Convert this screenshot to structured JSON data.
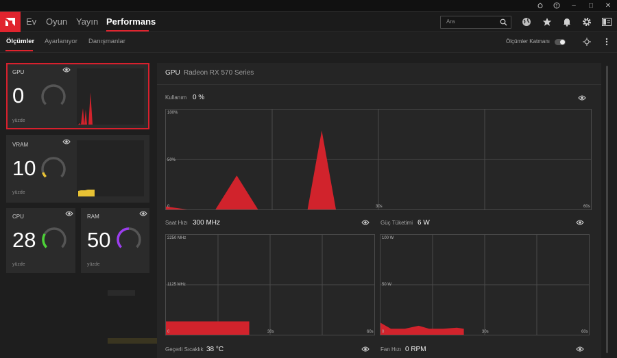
{
  "window": {
    "minimize": "–",
    "maximize": "□",
    "close": "✕"
  },
  "nav": {
    "items": [
      "Ev",
      "Oyun",
      "Yayın",
      "Performans"
    ],
    "active": "Performans"
  },
  "search": {
    "placeholder": "Ara"
  },
  "subnav": {
    "items": [
      "Ölçümler",
      "Ayarlanıyor",
      "Danışmanlar"
    ],
    "active": "Ölçümler",
    "overlay_label": "Ölçümler Katmanı"
  },
  "cards": {
    "gpu": {
      "label": "GPU",
      "value": "0",
      "unit": "yüzde",
      "gauge_color": "#555555",
      "fraction": 0.0
    },
    "vram": {
      "label": "VRAM",
      "value": "10",
      "unit": "yüzde",
      "gauge_color": "#e8c234",
      "fraction": 0.1
    },
    "cpu": {
      "label": "CPU",
      "value": "28",
      "unit": "yüzde",
      "gauge_color": "#4cd137",
      "fraction": 0.28
    },
    "ram": {
      "label": "RAM",
      "value": "50",
      "unit": "yüzde",
      "gauge_color": "#9c3df0",
      "fraction": 0.5
    }
  },
  "panel": {
    "title": "GPU",
    "subtitle": "Radeon RX 570 Series",
    "usage": {
      "label": "Kullanım",
      "value": "0 %"
    },
    "clock": {
      "label": "Saat Hızı",
      "value": "300 MHz"
    },
    "power": {
      "label": "Güç Tüketimi",
      "value": "6 W"
    },
    "temp": {
      "label": "Geçerli Sıcaklık",
      "value": "38 °C"
    },
    "fan": {
      "label": "Fan Hızı",
      "value": "0 RPM"
    }
  },
  "chart_data": [
    {
      "type": "area",
      "ylim": [
        0,
        100
      ],
      "yticks": [
        "100%",
        "50%",
        "0"
      ],
      "xticks": [
        "30s",
        "60s"
      ],
      "x": [
        0,
        3,
        5,
        7,
        10,
        13,
        16,
        19,
        20,
        22,
        24,
        26
      ],
      "values": [
        3,
        0,
        0,
        0,
        34,
        0,
        0,
        0,
        0,
        79,
        0,
        0
      ]
    },
    {
      "type": "area",
      "ylim": [
        0,
        2250
      ],
      "yticks": [
        "2250 MHz",
        "1125 MHz",
        "0"
      ],
      "xticks": [
        "30s",
        "60s"
      ],
      "x": [
        0,
        24
      ],
      "values": [
        300,
        300
      ]
    },
    {
      "type": "area",
      "ylim": [
        0,
        100
      ],
      "yticks": [
        "100 W",
        "50 W",
        "0"
      ],
      "xticks": [
        "30s",
        "60s"
      ],
      "x": [
        0,
        3,
        7,
        11,
        14,
        18,
        22,
        24
      ],
      "values": [
        12,
        6,
        6,
        9,
        6,
        6,
        7,
        6
      ]
    }
  ]
}
